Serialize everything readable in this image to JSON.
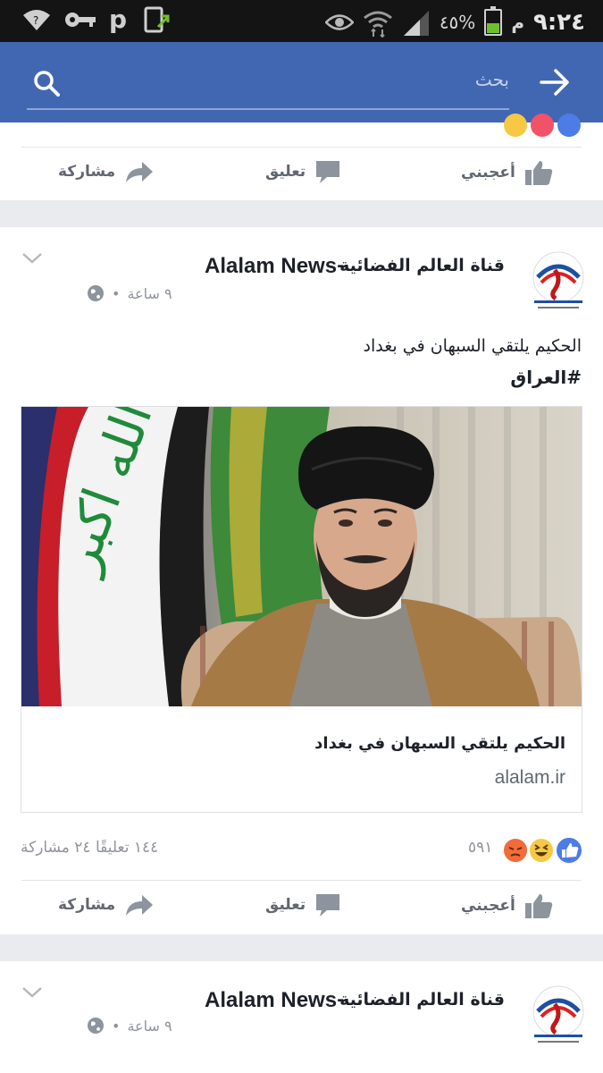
{
  "status_bar": {
    "time": "٩:٢٤",
    "am_pm": "م",
    "battery": "٤٥%",
    "battery_level": 0.45
  },
  "search": {
    "placeholder": "بحث"
  },
  "actions": {
    "like": "أعجبني",
    "comment": "تعليق",
    "share": "مشاركة"
  },
  "posts": [
    {
      "page_name": "Alalam News",
      "page_name_ar": "قناة العالم الفضائية",
      "separator": "-",
      "time": "٩ ساعة",
      "text": "الحكيم يلتقي السبهان في بغداد",
      "hashtag": "#العراق",
      "link": {
        "title": "الحكيم يلتقي السبهان في بغداد",
        "domain": "alalam.ir"
      },
      "reactions_count": "٥٩١",
      "comments_shares": "١٤٤ تعليقًا ٢٤ مشاركة"
    },
    {
      "page_name": "Alalam News",
      "page_name_ar": "قناة العالم الفضائية",
      "separator": "-",
      "time": "٩ ساعة"
    }
  ],
  "colors": {
    "header_blue": "#4267b2",
    "like_blue": "#4c7ce5",
    "haha_yellow": "#f7c844",
    "angry_orange": "#f26c3a"
  }
}
